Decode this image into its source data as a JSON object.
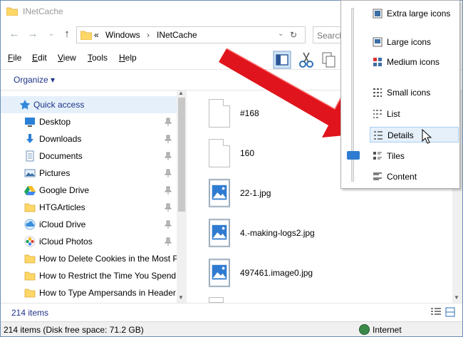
{
  "window": {
    "title": "INetCache"
  },
  "address": {
    "prefix": "«",
    "crumbs": [
      "Windows",
      "INetCache"
    ],
    "separator": "›",
    "search_placeholder": "Search"
  },
  "menu": {
    "items": [
      {
        "label": "File",
        "u": "F",
        "rest": "ile"
      },
      {
        "label": "Edit",
        "u": "E",
        "rest": "dit"
      },
      {
        "label": "View",
        "u": "V",
        "rest": "iew"
      },
      {
        "label": "Tools",
        "u": "T",
        "rest": "ools"
      },
      {
        "label": "Help",
        "u": "H",
        "rest": "elp"
      }
    ]
  },
  "command": {
    "organize": "Organize ▾"
  },
  "nav": {
    "items": [
      {
        "label": "Quick access",
        "icon": "star-icon",
        "pinned": false
      },
      {
        "label": "Desktop",
        "icon": "desktop-icon",
        "pinned": true
      },
      {
        "label": "Downloads",
        "icon": "download-icon",
        "pinned": true
      },
      {
        "label": "Documents",
        "icon": "document-icon",
        "pinned": true
      },
      {
        "label": "Pictures",
        "icon": "picture-icon",
        "pinned": true
      },
      {
        "label": "Google Drive",
        "icon": "google-drive-icon",
        "pinned": true
      },
      {
        "label": "HTGArticles",
        "icon": "folder-icon",
        "pinned": true
      },
      {
        "label": "iCloud Drive",
        "icon": "icloud-icon",
        "pinned": true
      },
      {
        "label": "iCloud Photos",
        "icon": "icloud-photos-icon",
        "pinned": true
      },
      {
        "label": "How to Delete Cookies in the Most P",
        "icon": "folder-icon",
        "pinned": false
      },
      {
        "label": "How to Restrict the Time You Spend",
        "icon": "folder-icon",
        "pinned": false
      },
      {
        "label": "How to Type Ampersands in Header",
        "icon": "folder-icon",
        "pinned": false
      }
    ]
  },
  "files": [
    {
      "name": "#168",
      "kind": "doc"
    },
    {
      "name": "160",
      "kind": "doc"
    },
    {
      "name": "22-1.jpg",
      "kind": "image"
    },
    {
      "name": "4.-making-logs2.jpg",
      "kind": "image"
    },
    {
      "name": "497461.image0.jpg",
      "kind": "image"
    }
  ],
  "status": {
    "count": "214 items",
    "details": "214 items (Disk free space: 71.2 GB)",
    "zone": "Internet"
  },
  "view_menu": {
    "items": [
      {
        "label": "Extra large icons"
      },
      {
        "label": "Large icons"
      },
      {
        "label": "Medium icons"
      },
      {
        "label": "Small icons"
      },
      {
        "label": "List"
      },
      {
        "label": "Details"
      },
      {
        "label": "Tiles"
      },
      {
        "label": "Content"
      }
    ],
    "selected": "Details"
  },
  "colors": {
    "accent": "#1e3287",
    "selection": "#e5f0fb",
    "folder": "#ffd766",
    "arrow": "#e0141c"
  }
}
